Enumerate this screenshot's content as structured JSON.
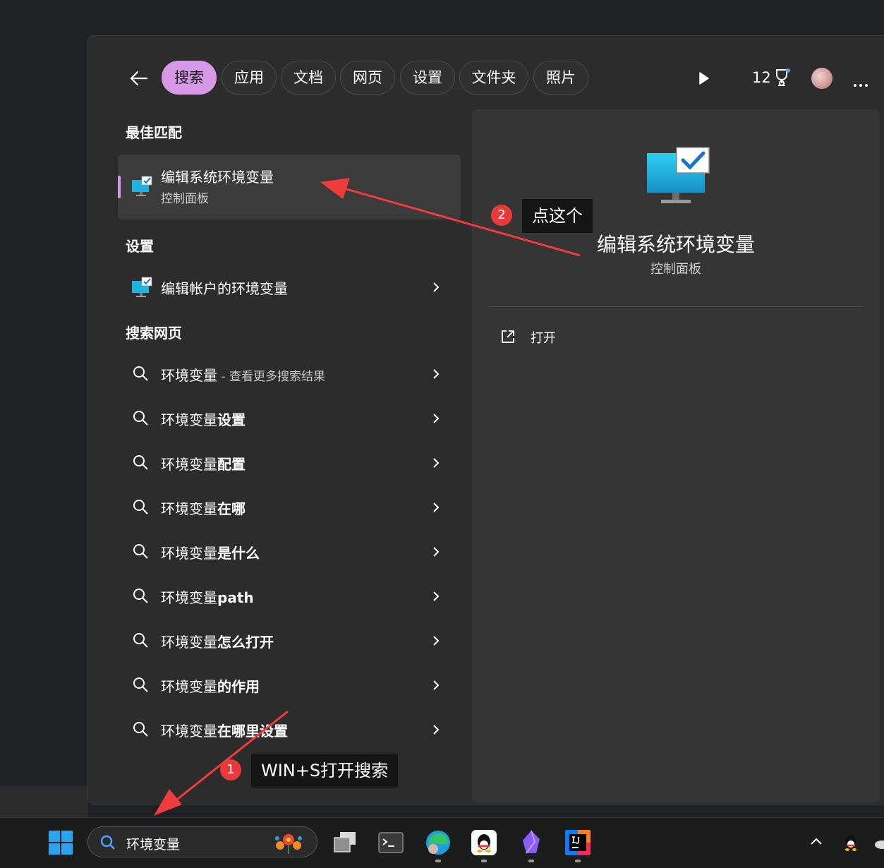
{
  "header": {
    "filters": [
      "搜索",
      "应用",
      "文档",
      "网页",
      "设置",
      "文件夹",
      "照片"
    ],
    "active_filter": "搜索",
    "points": "12"
  },
  "left": {
    "best_match_heading": "最佳匹配",
    "best_match": {
      "title": "编辑系统环境变量",
      "subtitle": "控制面板"
    },
    "settings_heading": "设置",
    "settings_item": "编辑帐户的环境变量",
    "web_heading": "搜索网页",
    "web_items": [
      {
        "prefix": "环境变量",
        "suffix": "",
        "extra": " - 查看更多搜索结果"
      },
      {
        "prefix": "环境变量",
        "suffix": "设置",
        "extra": ""
      },
      {
        "prefix": "环境变量",
        "suffix": "配置",
        "extra": ""
      },
      {
        "prefix": "环境变量",
        "suffix": "在哪",
        "extra": ""
      },
      {
        "prefix": "环境变量",
        "suffix": "是什么",
        "extra": ""
      },
      {
        "prefix": "环境变量",
        "suffix": "path",
        "extra": ""
      },
      {
        "prefix": "环境变量",
        "suffix": "怎么打开",
        "extra": ""
      },
      {
        "prefix": "环境变量",
        "suffix": "的作用",
        "extra": ""
      },
      {
        "prefix": "环境变量",
        "suffix": "在哪里设置",
        "extra": ""
      }
    ]
  },
  "right": {
    "title": "编辑系统环境变量",
    "subtitle": "控制面板",
    "action_open": "打开"
  },
  "annotations": {
    "step1_number": "1",
    "step1_text": "WIN+S打开搜索",
    "step2_number": "2",
    "step2_text": "点这个"
  },
  "taskbar": {
    "search_value": "环境变量"
  },
  "colors": {
    "accent": "#d699e7",
    "annotation_red": "#e83a3a"
  }
}
